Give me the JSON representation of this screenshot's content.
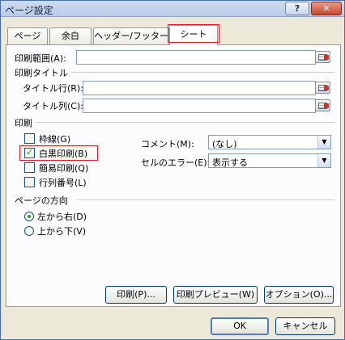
{
  "window": {
    "title": "ページ設定",
    "help_label": "?",
    "close_label": "✕"
  },
  "tabs": [
    {
      "label": "ページ"
    },
    {
      "label": "余白"
    },
    {
      "label": "ヘッダー/フッター"
    },
    {
      "label": "シート"
    }
  ],
  "print_area": {
    "label": "印刷範囲(A):",
    "value": ""
  },
  "print_titles": {
    "heading": "印刷タイトル",
    "rows_label": "タイトル行(R):",
    "rows_value": "",
    "cols_label": "タイトル列(C):",
    "cols_value": ""
  },
  "print": {
    "heading": "印刷",
    "gridlines": {
      "label": "枠線(G)",
      "checked": false
    },
    "black_white": {
      "label": "白黒印刷(B)",
      "checked": true
    },
    "draft": {
      "label": "簡易印刷(Q)",
      "checked": false
    },
    "headings": {
      "label": "行列番号(L)",
      "checked": false
    },
    "comments": {
      "label": "コメント(M):",
      "value": "(なし)"
    },
    "cell_errors": {
      "label": "セルのエラー(E):",
      "value": "表示する"
    }
  },
  "page_order": {
    "heading": "ページの方向",
    "down_then_over": {
      "label": "左から右(D)",
      "selected": true
    },
    "over_then_down": {
      "label": "上から下(V)",
      "selected": false
    }
  },
  "panel_buttons": {
    "print": "印刷(P)...",
    "preview": "印刷プレビュー(W)",
    "options": "オプション(O)..."
  },
  "dialog_buttons": {
    "ok": "OK",
    "cancel": "キャンセル"
  },
  "colors": {
    "highlight": "#e0191e",
    "check": "#21a121",
    "field_border": "#7f9db9"
  }
}
